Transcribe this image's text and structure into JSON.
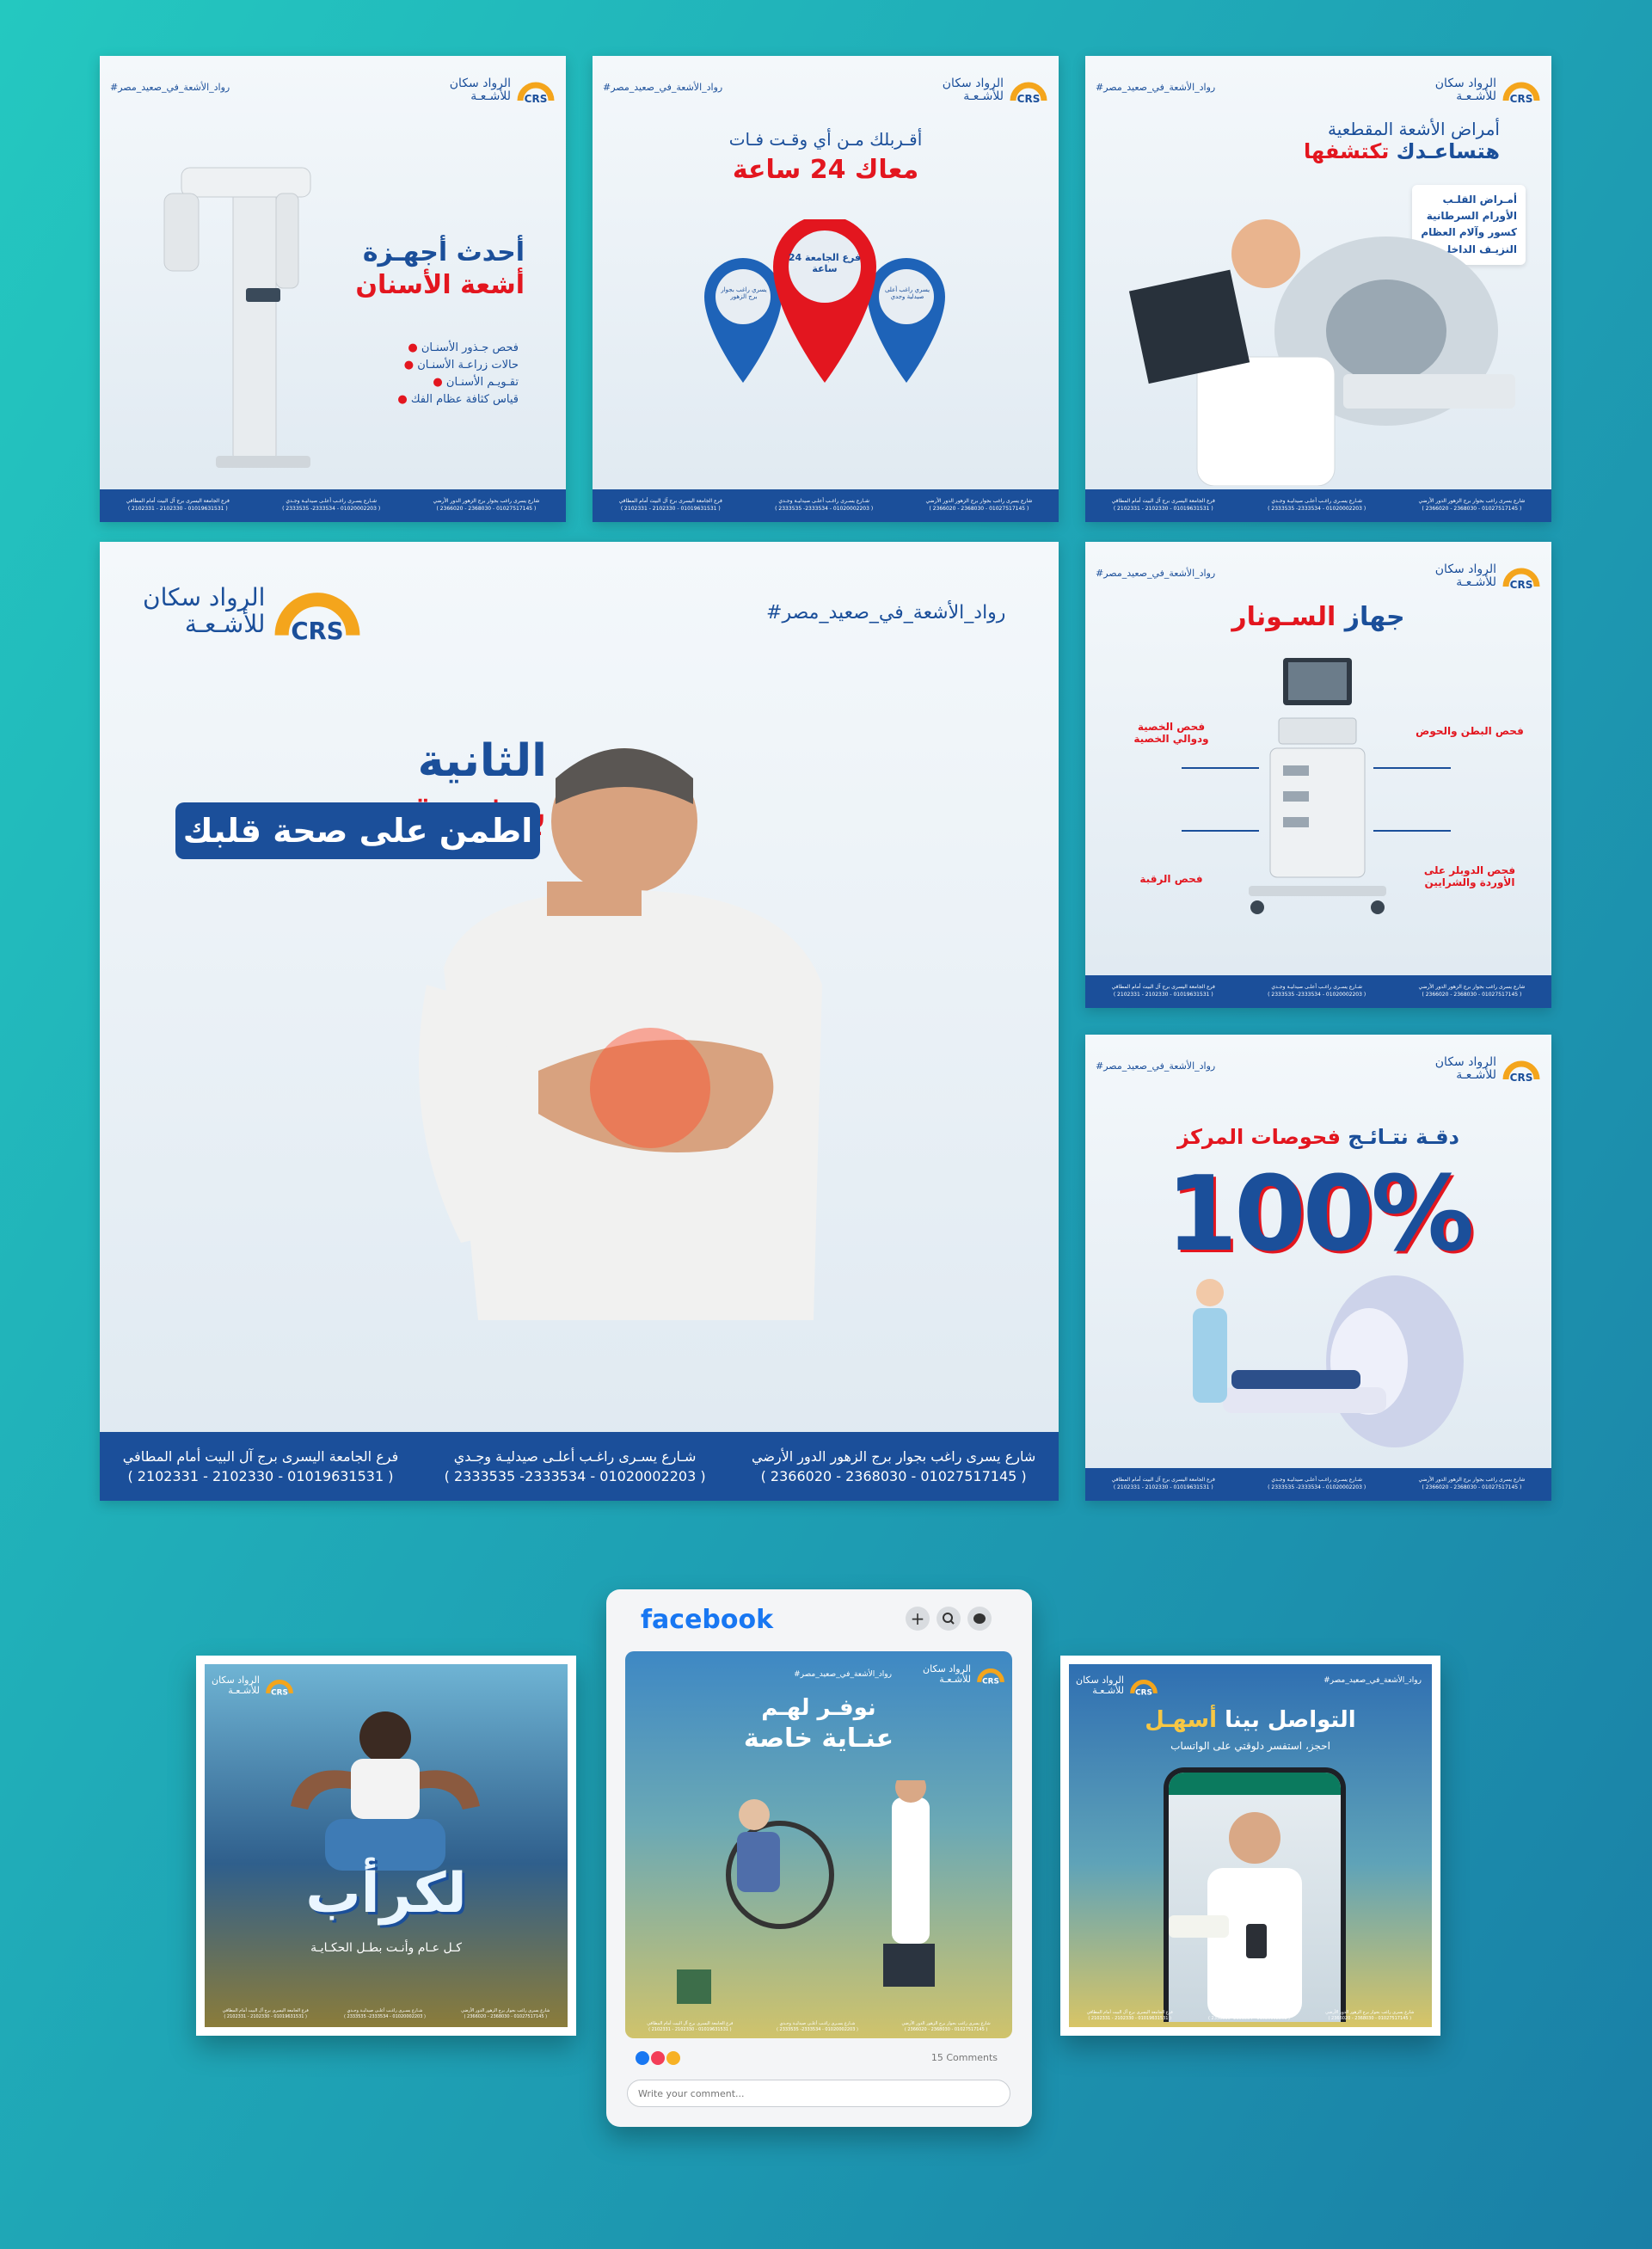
{
  "brand": {
    "name_line1": "الرواد سكان",
    "name_line2": "للأشـعـة",
    "logo_initials": "CRS",
    "hashtag": "#رواد_الأشعة_في_صعيد_مصر"
  },
  "footer": {
    "branch1_address": "شارع يسرى راغب بجوار برج الزهور الدور الأرضي",
    "branch1_phones": "( 2366020 - 2368030 - 01027517145 )",
    "branch2_address": "شـارع يسـرى راغـب أعلـى صيدليـة وجـدي",
    "branch2_phones": "( 2333535 -2333534 - 01020002203 )",
    "branch3_address": "فرع الجامعة اليسرى برج آل البيت أمام المطافي",
    "branch3_phones": "( 2102331 - 2102330 - 01019631531 )"
  },
  "cards": {
    "dental": {
      "title1": "أحدث أجهـزة",
      "title2": "أشعة الأسنان",
      "items": [
        "فحص جـذور الأسنـان",
        "حالات زراعـة الأسنـان",
        "تقـويـم الأسنـان",
        "قياس كثافة عظام الفك"
      ]
    },
    "location": {
      "top": "أقـربلك مـن أي وقـت فـات",
      "main": "معاك 24 ساعة",
      "pin_center": "فرع الجامعة 24 ساعة",
      "pin_left": "يسري راغب بجوار برج الزهور",
      "pin_right": "يسري راغب أعلى صيدلية وجدي"
    },
    "ct": {
      "title1": "أمراض الأشعة المقطعية",
      "title2a": "هتساعـدك",
      "title2b": "تكتشفها",
      "list": [
        "أمـراض القلـب",
        "الأورام السرطانية",
        "كسور وآلام العظام",
        "النزيـف الداخلـي"
      ]
    },
    "heart": {
      "line1a": "الثانية",
      "line1b": "بتفـرق",
      "line2": "اطمن على صحة قلبك"
    },
    "sonar": {
      "title_a": "جهاز",
      "title_b": "السـونار",
      "label_tl": "فحص الخصية ودوالي الخصية",
      "label_tr": "فحص البطن والحوض",
      "label_bl": "فحص الرقبة",
      "label_br": "فحص الدوبلر على الأوردة والشرايين"
    },
    "accuracy": {
      "line_a": "دقـة نتـائـج",
      "line_b": "فحوصات المركز",
      "percent": "100%"
    },
    "bottom_left": {
      "big": "لكرأب",
      "sub": "كـل عـام وأنـت بطـل الحكـايـة"
    },
    "facebook_post": {
      "line1": "نوفـر لهـم",
      "line2": "عنـاية خاصة"
    },
    "whatsapp": {
      "title_a": "التواصل بينا",
      "title_b": "أسهـل",
      "sub": "احجز، استفسر دلوقتي على الواتساب"
    }
  },
  "facebook": {
    "logo": "facebook",
    "comments": "15 Comments",
    "comment_placeholder": "Write your comment..."
  }
}
